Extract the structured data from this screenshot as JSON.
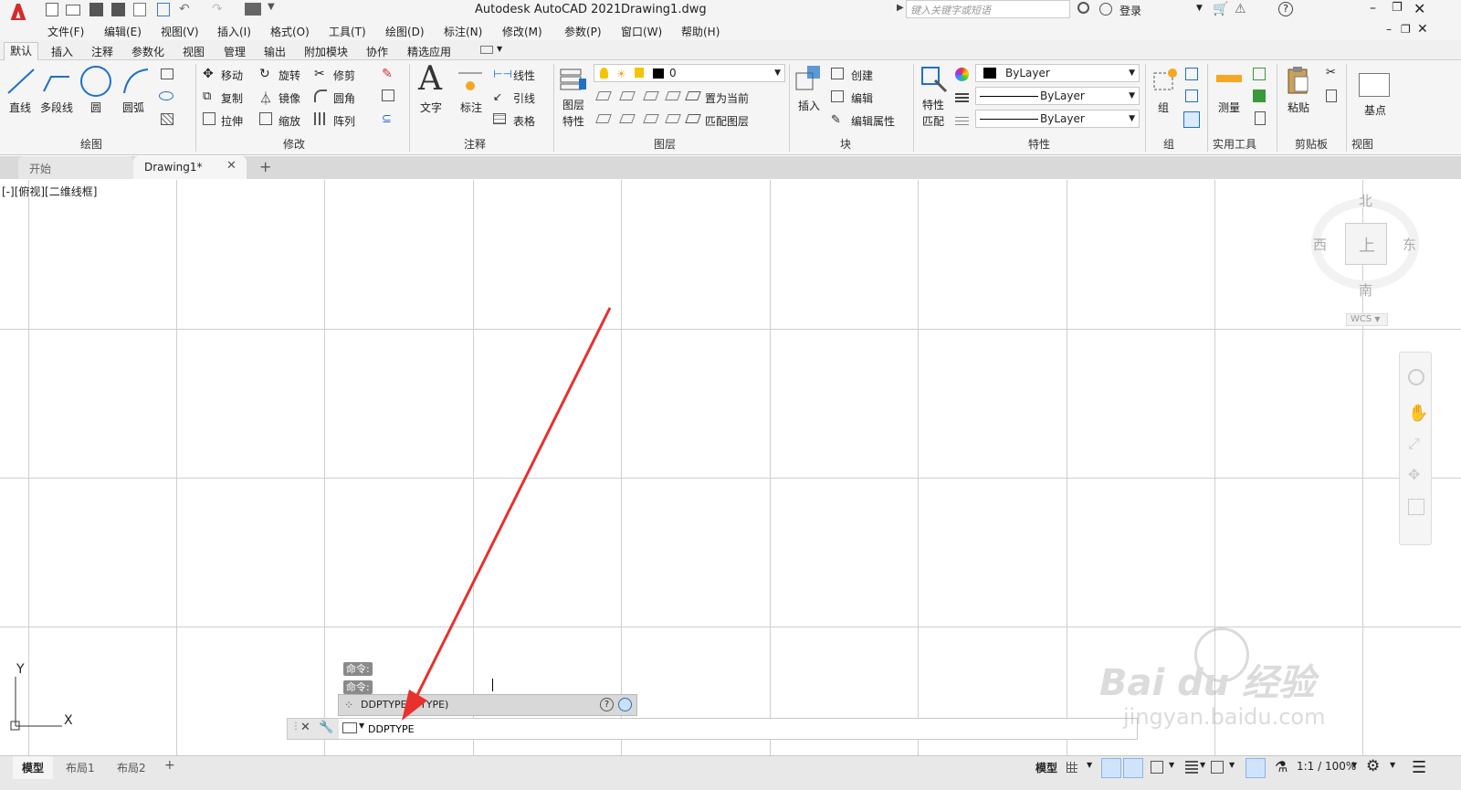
{
  "title_bar": {
    "app_title": "Autodesk AutoCAD 2021",
    "doc_title": "Drawing1.dwg",
    "search_placeholder": "键入关键字或短语",
    "login": "登录"
  },
  "menu": [
    "文件(F)",
    "编辑(E)",
    "视图(V)",
    "插入(I)",
    "格式(O)",
    "工具(T)",
    "绘图(D)",
    "标注(N)",
    "修改(M)",
    "参数(P)",
    "窗口(W)",
    "帮助(H)"
  ],
  "ribbon_tabs": [
    "默认",
    "插入",
    "注释",
    "参数化",
    "视图",
    "管理",
    "输出",
    "附加模块",
    "协作",
    "精选应用"
  ],
  "ribbon": {
    "draw": {
      "line": "直线",
      "polyline": "多段线",
      "circle": "圆",
      "arc": "圆弧",
      "panel": "绘图"
    },
    "modify": {
      "move": "移动",
      "rotate": "旋转",
      "trim": "修剪",
      "copy": "复制",
      "mirror": "镜像",
      "fillet": "圆角",
      "stretch": "拉伸",
      "scale": "缩放",
      "array": "阵列",
      "panel": "修改"
    },
    "annotation": {
      "text": "文字",
      "dimension": "标注",
      "linear": "线性",
      "leader": "引线",
      "table": "表格",
      "panel": "注释"
    },
    "layers": {
      "layer_props_1": "图层",
      "layer_props_2": "特性",
      "current_layer": "0",
      "set_current": "置为当前",
      "match_layer": "匹配图层",
      "panel": "图层"
    },
    "block": {
      "insert": "插入",
      "create": "创建",
      "edit": "编辑",
      "edit_attr": "编辑属性",
      "panel": "块"
    },
    "properties": {
      "match_1": "特性",
      "match_2": "匹配",
      "color": "ByLayer",
      "linetype": "ByLayer",
      "lineweight": "ByLayer",
      "panel": "特性"
    },
    "groups": {
      "group": "组",
      "panel": "组"
    },
    "utilities": {
      "measure": "测量",
      "panel": "实用工具"
    },
    "clipboard": {
      "paste": "粘贴",
      "panel": "剪贴板"
    },
    "view": {
      "basepoint": "基点",
      "panel": "视图"
    }
  },
  "doc_tabs": {
    "start": "开始",
    "drawing": "Drawing1*"
  },
  "viewport_label": "[-][俯视][二维线框]",
  "viewcube": {
    "north": "北",
    "south": "南",
    "east": "东",
    "west": "西",
    "top": "上",
    "wcs": "WCS"
  },
  "ucs": {
    "x": "X",
    "y": "Y"
  },
  "command": {
    "history": [
      "命令:",
      "命令:"
    ],
    "suggestion": "DDPTYPE (PTYPE)",
    "input_value": "DDPTYPE"
  },
  "layout_tabs": [
    "模型",
    "布局1",
    "布局2"
  ],
  "status": {
    "model": "模型",
    "scale": "1:1 / 100%"
  },
  "watermark": {
    "brand": "Bai du 经验",
    "url": "jingyan.baidu.com"
  },
  "colors": {
    "arrow": "#e8302c",
    "autocad_red": "#d62b2b",
    "accent_blue": "#1e70c8"
  }
}
